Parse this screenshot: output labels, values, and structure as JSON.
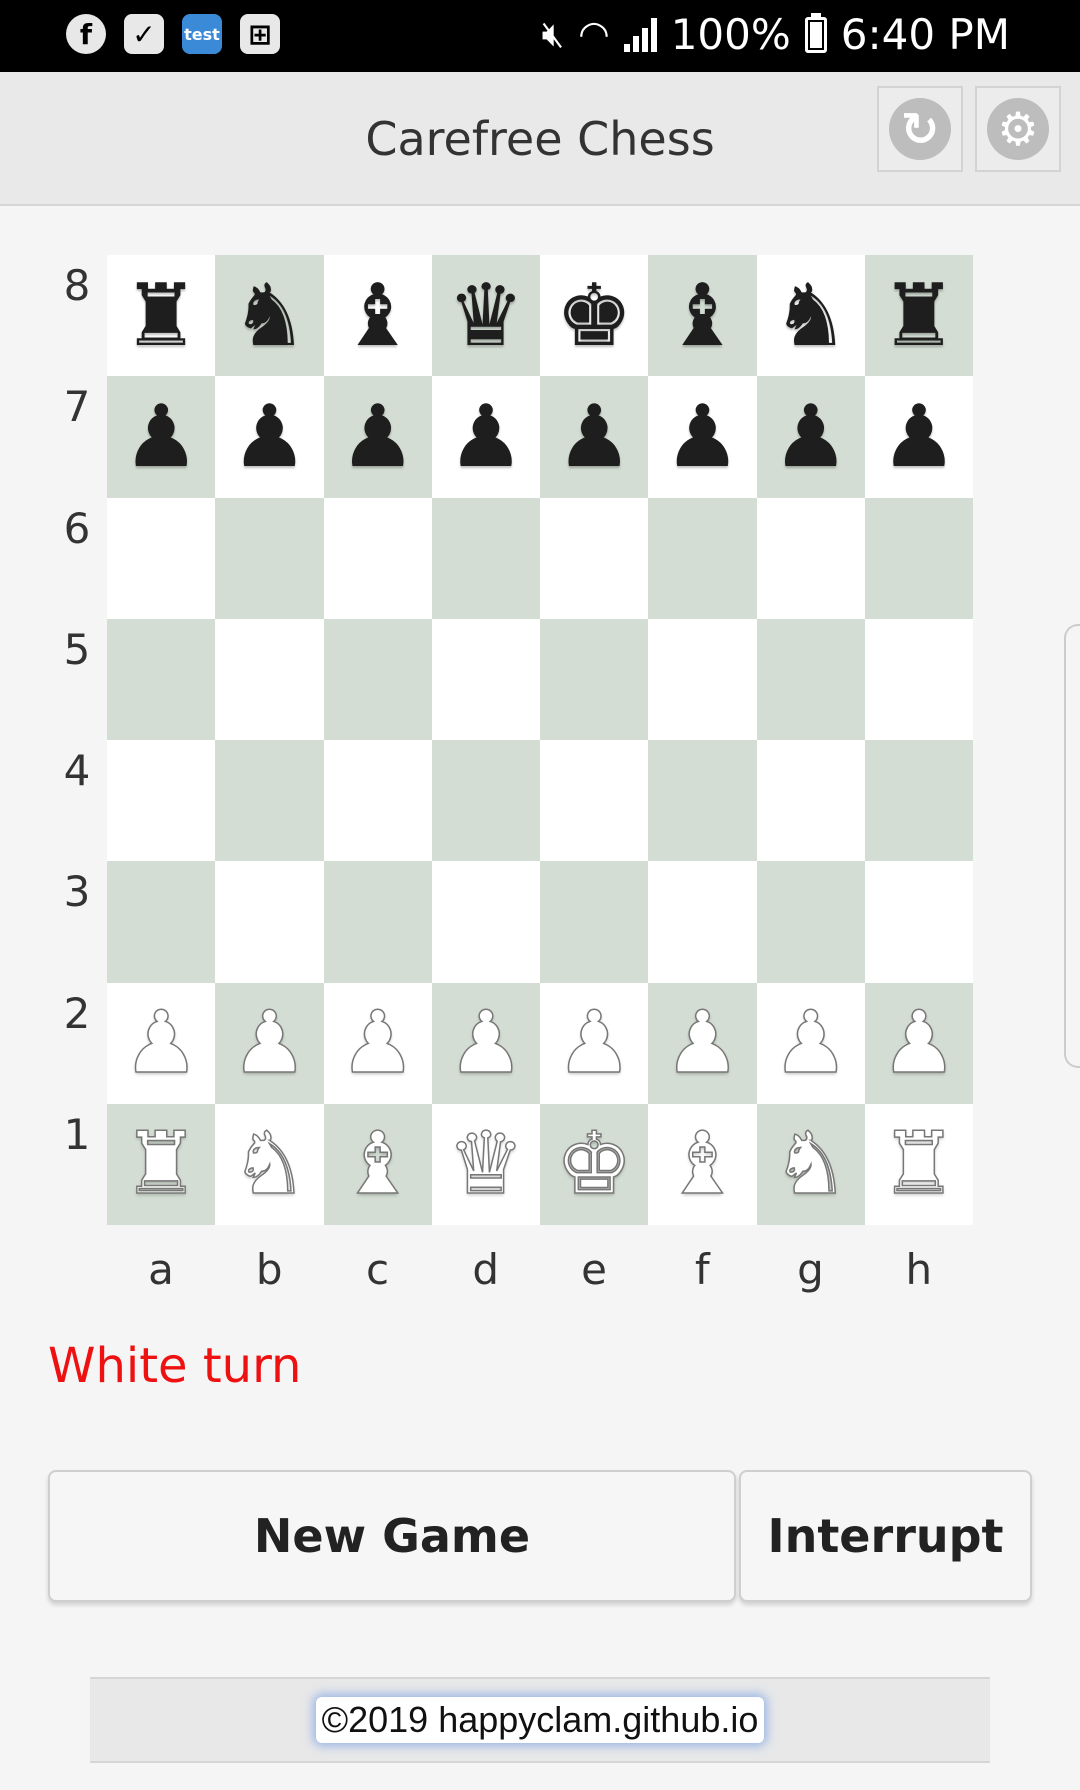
{
  "status_bar": {
    "left_icons": [
      "facebook-icon",
      "task-check-icon",
      "cloud-test-icon",
      "data-saver-icon"
    ],
    "cloud_label": "test",
    "battery": "100%",
    "time": "6:40 PM"
  },
  "header": {
    "title": "Carefree Chess",
    "icons": [
      "refresh-icon",
      "gear-icon"
    ]
  },
  "board": {
    "ranks": [
      "8",
      "7",
      "6",
      "5",
      "4",
      "3",
      "2",
      "1"
    ],
    "files": [
      "a",
      "b",
      "c",
      "d",
      "e",
      "f",
      "g",
      "h"
    ],
    "position": [
      [
        "br",
        "bn",
        "bb",
        "bq",
        "bk",
        "bb",
        "bn",
        "br"
      ],
      [
        "bp",
        "bp",
        "bp",
        "bp",
        "bp",
        "bp",
        "bp",
        "bp"
      ],
      [
        "",
        "",
        "",
        "",
        "",
        "",
        "",
        ""
      ],
      [
        "",
        "",
        "",
        "",
        "",
        "",
        "",
        ""
      ],
      [
        "",
        "",
        "",
        "",
        "",
        "",
        "",
        ""
      ],
      [
        "",
        "",
        "",
        "",
        "",
        "",
        "",
        ""
      ],
      [
        "wp",
        "wp",
        "wp",
        "wp",
        "wp",
        "wp",
        "wp",
        "wp"
      ],
      [
        "wr",
        "wn",
        "wb",
        "wq",
        "wk",
        "wb",
        "wn",
        "wr"
      ]
    ],
    "colors": {
      "light": "#ffffff",
      "dark": "#d3ddd3"
    }
  },
  "status": {
    "turn_text": "White turn",
    "turn_color": "#ee1111"
  },
  "buttons": {
    "new_game": "New Game",
    "interrupt": "Interrupt"
  },
  "footer": {
    "text": "©2019 happyclam.github.io"
  }
}
